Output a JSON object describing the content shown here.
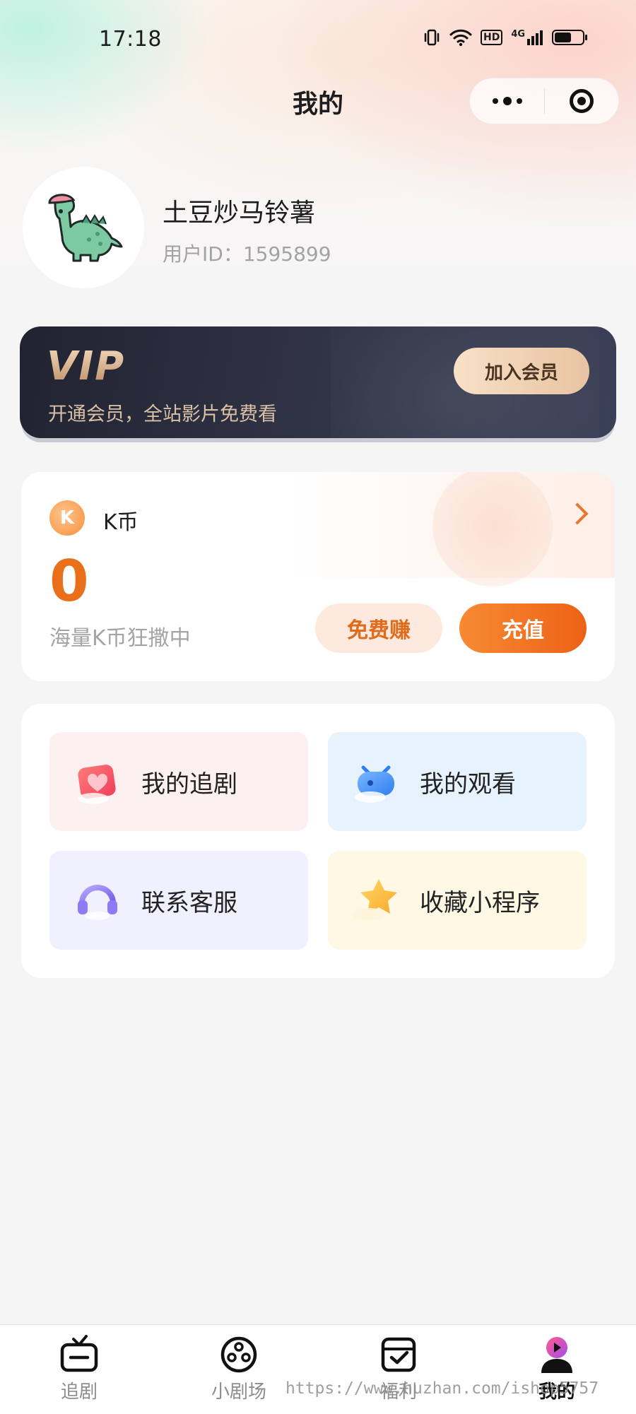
{
  "status_bar": {
    "time": "17:18",
    "network_badge": "HD",
    "network_type": "4G",
    "battery_level": 0.6
  },
  "header": {
    "title": "我的"
  },
  "profile": {
    "username": "土豆炒马铃薯",
    "user_id": "用户ID：1595899"
  },
  "vip": {
    "logo_text": "VIP",
    "subtitle": "开通会员，全站影片免费看",
    "join_button": "加入会员"
  },
  "coins": {
    "label": "K币",
    "icon_letter": "K",
    "balance": "0",
    "description": "海量K币狂撒中",
    "earn_button": "免费赚",
    "recharge_button": "充值",
    "accent_color": "#ea6f1b"
  },
  "menu": {
    "items": [
      {
        "label": "我的追剧",
        "icon": "heart-icon",
        "bg": "#fdf0f0"
      },
      {
        "label": "我的观看",
        "icon": "watch-icon",
        "bg": "#e6f2fe"
      },
      {
        "label": "联系客服",
        "icon": "headset-icon",
        "bg": "#f1f0fe"
      },
      {
        "label": "收藏小程序",
        "icon": "star-icon",
        "bg": "#fef8e4"
      }
    ]
  },
  "tabbar": {
    "items": [
      {
        "label": "追剧",
        "icon": "tv-icon",
        "active": false
      },
      {
        "label": "小剧场",
        "icon": "film-reel-icon",
        "active": false
      },
      {
        "label": "福利",
        "icon": "gift-icon",
        "active": false
      },
      {
        "label": "我的",
        "icon": "user-play-icon",
        "active": true
      }
    ]
  },
  "watermark": "https://www.huzhan.com/ishop5757"
}
